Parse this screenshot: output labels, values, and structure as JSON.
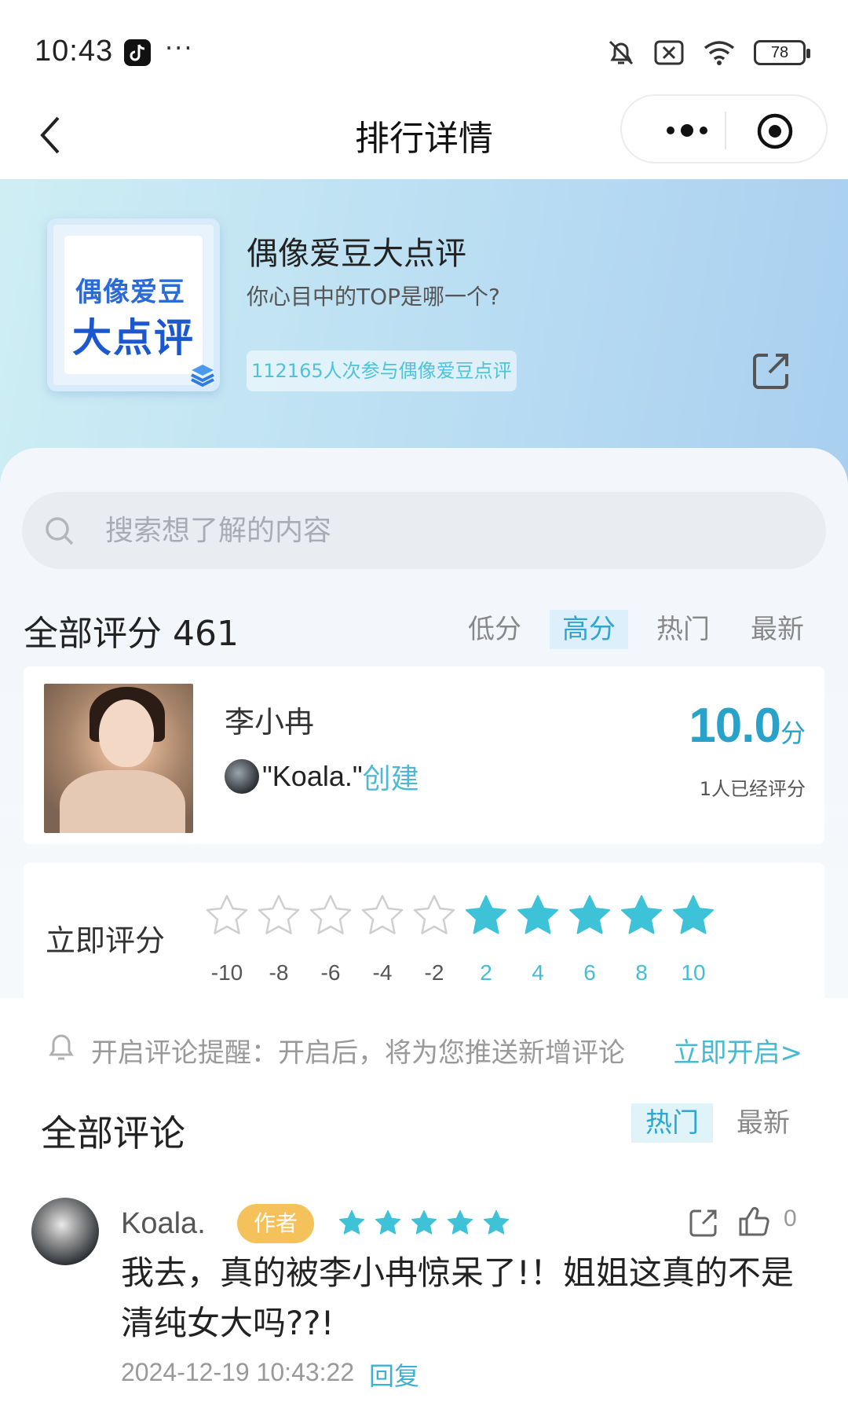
{
  "status_bar": {
    "time": "10:43",
    "more": "···",
    "battery": "78",
    "icons": [
      "tiktok-icon",
      "mute-icon",
      "sim-icon",
      "wifi-icon",
      "battery-icon"
    ]
  },
  "nav": {
    "title": "排行详情",
    "icons": [
      "back-icon",
      "more-icon",
      "target-icon"
    ]
  },
  "banner": {
    "cover_line1": "偶像爱豆",
    "cover_line2": "大点评",
    "title": "偶像爱豆大点评",
    "subtitle": "你心目中的TOP是哪一个?",
    "participants": "112165人次参与偶像爱豆点评"
  },
  "search": {
    "placeholder": "搜索想了解的内容"
  },
  "ratings": {
    "header": "全部评分 461",
    "sort_tabs": [
      {
        "label": "低分",
        "active": false
      },
      {
        "label": "高分",
        "active": true
      },
      {
        "label": "热门",
        "active": false
      },
      {
        "label": "最新",
        "active": false
      }
    ]
  },
  "item": {
    "name": "李小冉",
    "creator": "\"Koala.\"",
    "creator_action": "创建",
    "score": "10.0",
    "score_unit": "分",
    "rated_count": "1人已经评分"
  },
  "rate_now": {
    "label": "立即评分",
    "star_values": [
      "-10",
      "-8",
      "-6",
      "-4",
      "-2",
      "2",
      "4",
      "6",
      "8",
      "10"
    ],
    "filled_from_index": 5
  },
  "notify": {
    "text": "开启评论提醒：开启后，将为您推送新增评论",
    "action": "立即开启>"
  },
  "comments": {
    "title": "全部评论",
    "tabs": [
      {
        "label": "热门",
        "active": true
      },
      {
        "label": "最新",
        "active": false
      }
    ],
    "items": [
      {
        "user": "Koala.",
        "badge": "作者",
        "stars": 5,
        "likes": "0",
        "text": "我去，真的被李小冉惊呆了!！姐姐这真的不是清纯女大吗??!",
        "time": "2024-12-19 10:43:22",
        "reply": "回复"
      }
    ]
  },
  "colors": {
    "accent": "#31a5cf",
    "star_filled": "#3ec2d8",
    "badge": "#f4c15a"
  }
}
